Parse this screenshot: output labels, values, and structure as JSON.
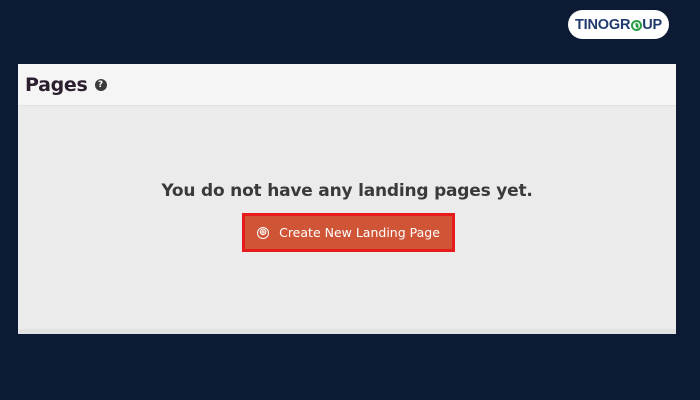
{
  "brand": {
    "part1": "TINO",
    "part2a": "GR",
    "part2b": "UP"
  },
  "header": {
    "title": "Pages",
    "help_icon": "?"
  },
  "main": {
    "empty_message": "You do not have any landing pages yet.",
    "create_button": {
      "icon": "⊕",
      "label": "Create New Landing Page"
    }
  },
  "colors": {
    "background": "#0c1a33",
    "panel": "#ecebec",
    "button": "#cf5536",
    "highlight": "#e61b1b",
    "brand_green": "#2a9d46",
    "brand_blue": "#1f3b6e"
  }
}
